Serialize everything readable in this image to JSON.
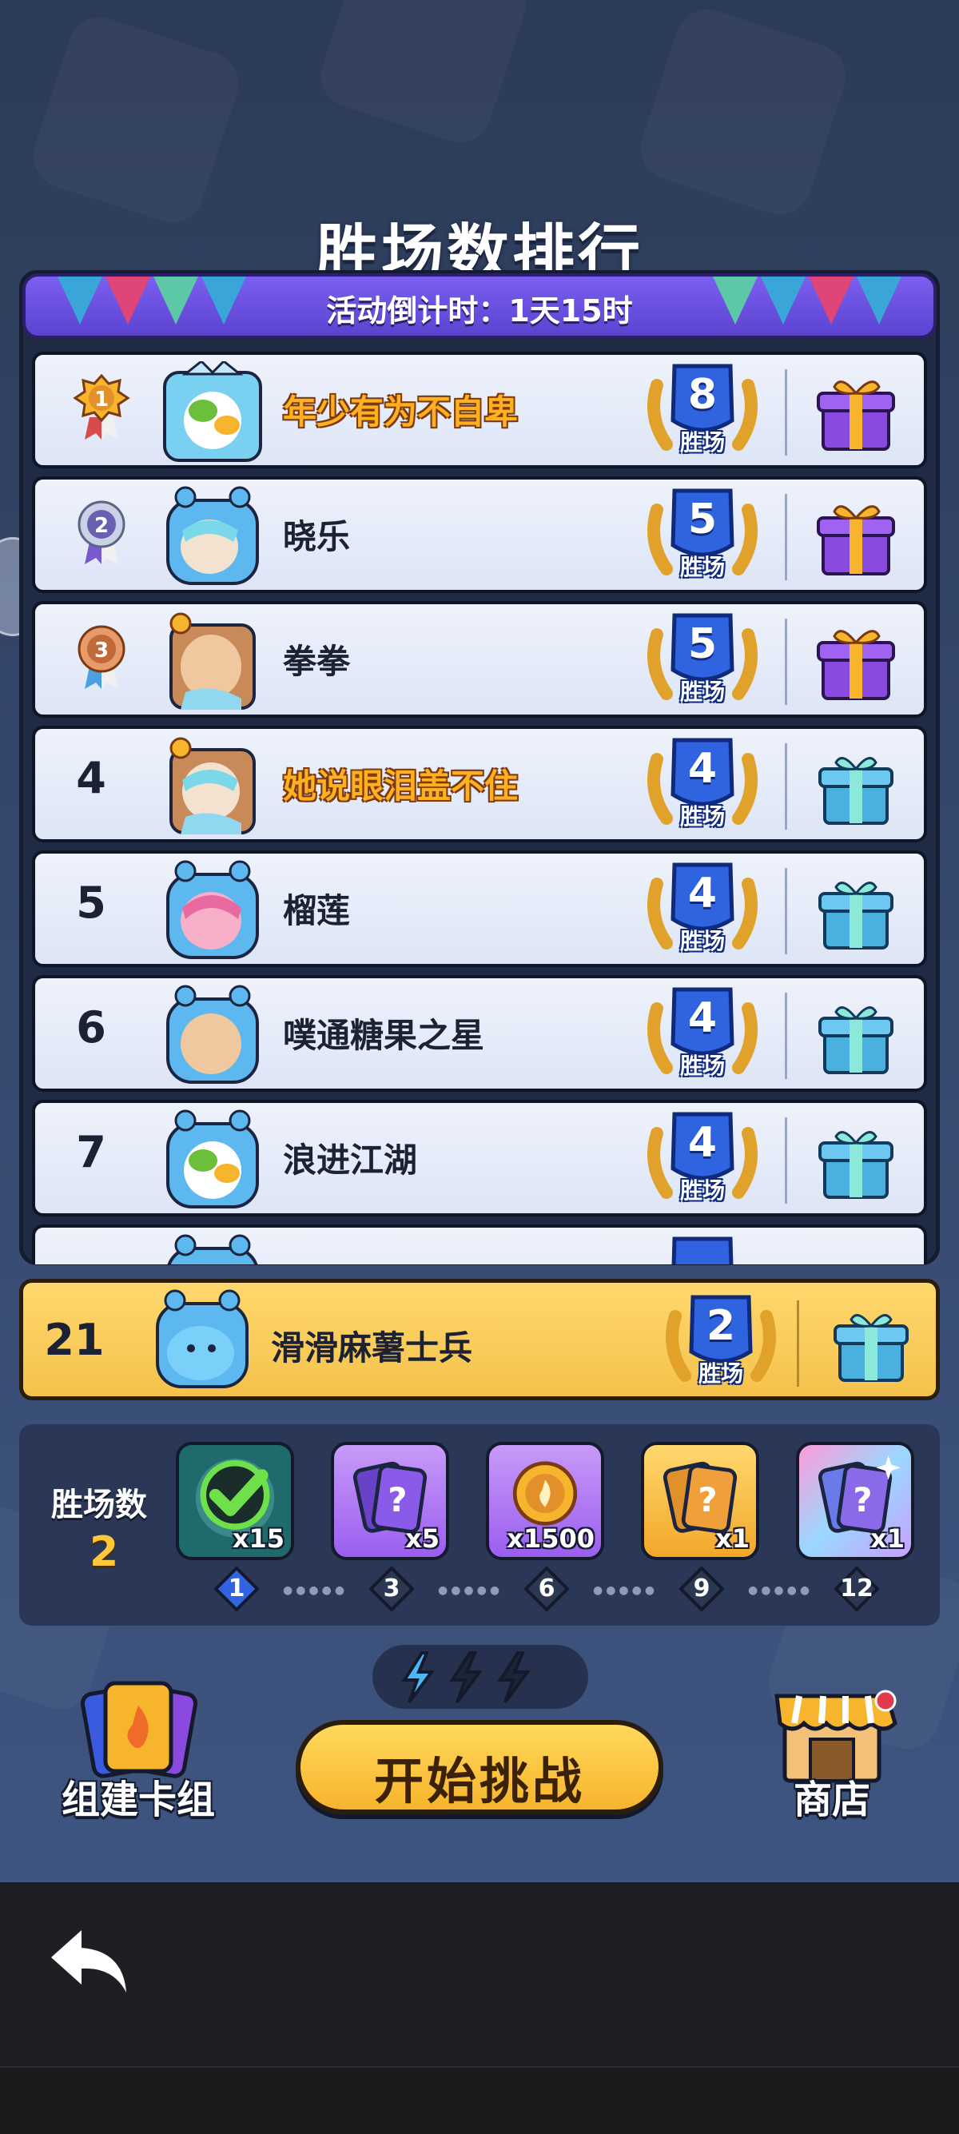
{
  "title": "胜场数排行",
  "countdown": "活动倒计时：1天15时",
  "wins_label": "胜场",
  "leaderboard": [
    {
      "rank": "1",
      "name": "年少有为不自卑",
      "wins": "8",
      "highlight": true,
      "gift": "purple"
    },
    {
      "rank": "2",
      "name": "晓乐",
      "wins": "5",
      "highlight": false,
      "gift": "purple"
    },
    {
      "rank": "3",
      "name": "拳拳",
      "wins": "5",
      "highlight": false,
      "gift": "purple"
    },
    {
      "rank": "4",
      "name": "她说眼泪盖不住",
      "wins": "4",
      "highlight": true,
      "gift": "blue"
    },
    {
      "rank": "5",
      "name": "榴莲",
      "wins": "4",
      "highlight": false,
      "gift": "blue"
    },
    {
      "rank": "6",
      "name": "噗通糖果之星",
      "wins": "4",
      "highlight": false,
      "gift": "blue"
    },
    {
      "rank": "7",
      "name": "浪进江湖",
      "wins": "4",
      "highlight": false,
      "gift": "blue"
    },
    {
      "rank": "",
      "name": "",
      "wins": "",
      "highlight": false,
      "gift": "blue"
    }
  ],
  "self": {
    "rank": "21",
    "name": "滑滑麻薯士兵",
    "wins": "2"
  },
  "progress": {
    "label": "胜场数",
    "count": "2",
    "rewards": [
      {
        "qty": "x15",
        "type": "checked",
        "milestone": "1"
      },
      {
        "qty": "x5",
        "type": "purple-card",
        "milestone": "3"
      },
      {
        "qty": "x1500",
        "type": "coin",
        "milestone": "6"
      },
      {
        "qty": "x1",
        "type": "gold-card",
        "milestone": "9"
      },
      {
        "qty": "x1",
        "type": "rainbow-card",
        "milestone": "12"
      }
    ]
  },
  "energy": {
    "filled": 1,
    "total": 3
  },
  "buttons": {
    "build_deck": "组建卡组",
    "start": "开始挑战",
    "shop": "商店"
  },
  "colors": {
    "accent_gold": "#f7b42d",
    "banner_purple": "#6a52e0",
    "win_blue": "#2f63e0"
  }
}
